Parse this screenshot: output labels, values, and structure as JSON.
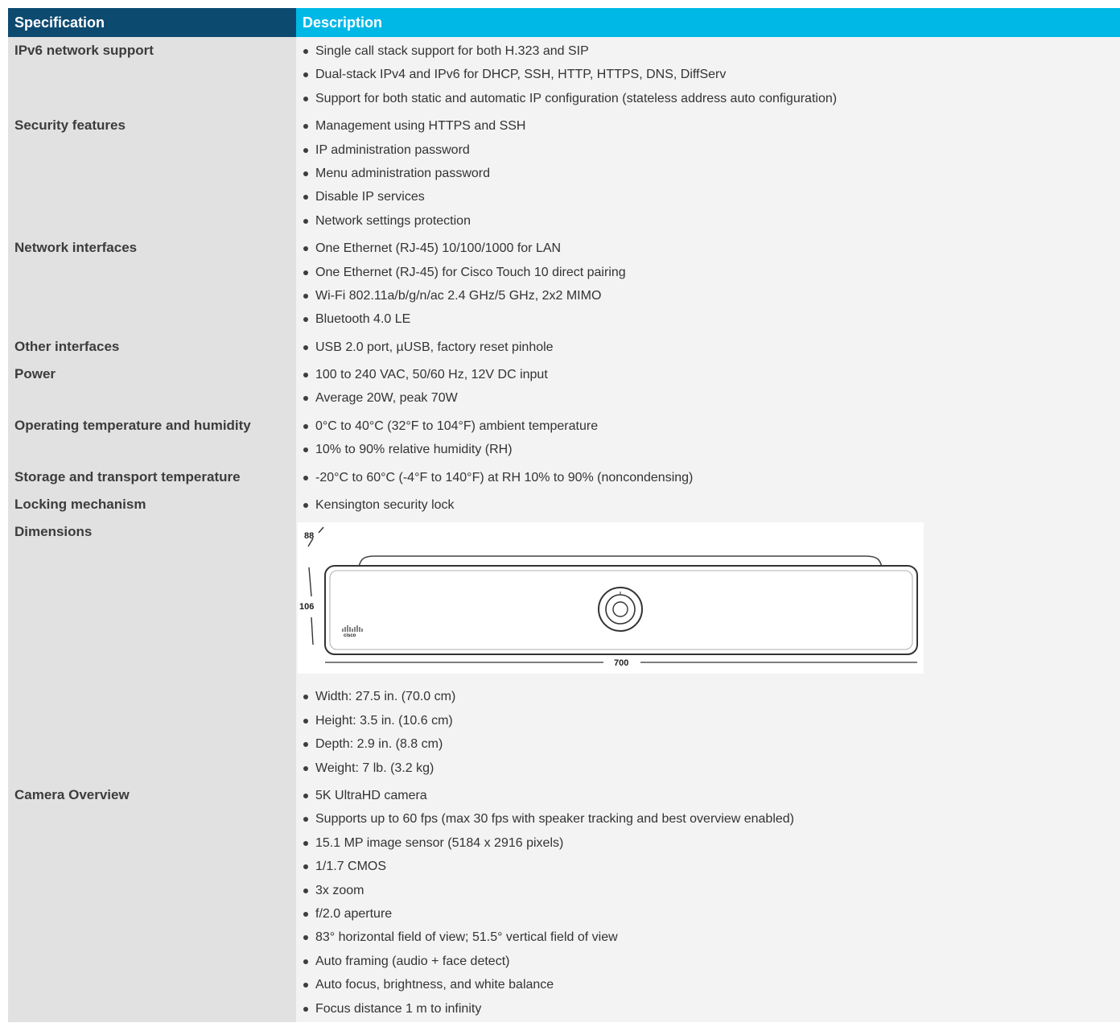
{
  "table": {
    "headers": {
      "specification": "Specification",
      "description": "Description"
    },
    "rows": [
      {
        "label": "IPv6 network support",
        "items": [
          "Single call stack support for both H.323 and SIP",
          "Dual-stack IPv4 and IPv6 for DHCP, SSH, HTTP, HTTPS, DNS, DiffServ",
          "Support for both static and automatic IP configuration (stateless address auto configuration)"
        ]
      },
      {
        "label": "Security features",
        "items": [
          "Management using HTTPS and SSH",
          "IP administration password",
          "Menu administration password",
          "Disable IP services",
          "Network settings protection"
        ]
      },
      {
        "label": "Network interfaces",
        "items": [
          "One Ethernet (RJ-45) 10/100/1000 for LAN",
          "One Ethernet (RJ-45) for Cisco Touch 10 direct pairing",
          "Wi-Fi 802.11a/b/g/n/ac 2.4 GHz/5 GHz, 2x2 MIMO",
          "Bluetooth 4.0 LE"
        ]
      },
      {
        "label": "Other interfaces",
        "items": [
          "USB 2.0 port, µUSB, factory reset pinhole"
        ]
      },
      {
        "label": "Power",
        "items": [
          "100 to 240 VAC, 50/60 Hz, 12V DC input",
          "Average 20W, peak 70W"
        ]
      },
      {
        "label": "Operating temperature and humidity",
        "items": [
          "0°C to 40°C (32°F to 104°F) ambient temperature",
          "10% to 90% relative humidity (RH)"
        ]
      },
      {
        "label": "Storage and transport temperature",
        "items": [
          "-20°C to 60°C (-4°F to 140°F) at RH 10% to 90% (noncondensing)"
        ]
      },
      {
        "label": "Locking mechanism",
        "items": [
          "Kensington security lock"
        ]
      },
      {
        "label": "Dimensions",
        "figure": {
          "depth_label": "88",
          "height_label": "106",
          "width_label": "700",
          "logo_text": "cisco"
        },
        "items": [
          "Width: 27.5 in. (70.0 cm)",
          "Height: 3.5 in. (10.6 cm)",
          "Depth: 2.9 in. (8.8 cm)",
          "Weight: 7 lb. (3.2 kg)"
        ]
      },
      {
        "label": "Camera Overview",
        "items": [
          "5K UltraHD camera",
          "Supports up to 60 fps (max 30 fps with speaker tracking and best overview enabled)",
          "15.1 MP image sensor (5184 x 2916 pixels)",
          "1/1.7 CMOS",
          "3x zoom",
          "f/2.0 aperture",
          "83° horizontal field of view; 51.5° vertical field of view",
          "Auto framing (audio + face detect)",
          "Auto focus, brightness, and white balance",
          "Focus distance 1 m to infinity"
        ]
      }
    ]
  }
}
